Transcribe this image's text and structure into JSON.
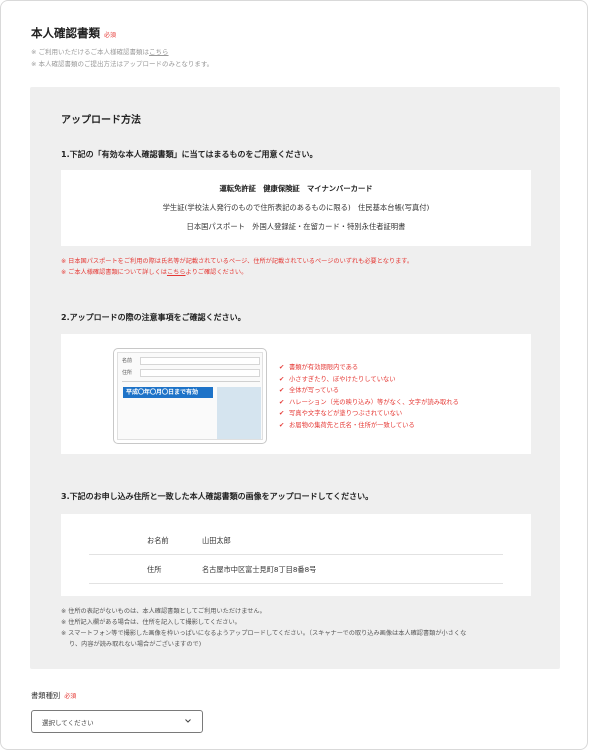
{
  "header": {
    "title": "本人確認書類",
    "required_badge": "必須",
    "note1_prefix": "※ ご利用いただけるご本人様確認書類は",
    "note1_link": "こちら",
    "note2": "※ 本人確認書類のご提出方法はアップロードのみとなります。"
  },
  "upload": {
    "heading": "アップロード方法",
    "step1": {
      "title": "1.下記の「有効な本人確認書類」に当てはまるものをご用意ください。",
      "docs": [
        "運転免許証　健康保険証　マイナンバーカード",
        "学生証(学校法人発行のもので住所表記のあるものに限る)　住民基本台帳(写真付)",
        "日本国パスポート　外国人登録証・在留カード・特別永住者証明書"
      ],
      "note1": "※ 日本国パスポートをご利用の際は氏名等が記載されているページ、住所が記載されているページのいずれも必要となります。",
      "note2_prefix": "※ ご本人様確認書類について詳しくは",
      "note2_link": "こちら",
      "note2_suffix": "よりご確認ください。"
    },
    "step2": {
      "title": "2.アップロードの際の注意事項をご確認ください。",
      "illustration": {
        "name_label": "名前",
        "address_label": "住所",
        "expiry_text": "平成〇年〇月〇日まで有効"
      },
      "checklist": [
        "書類が有効期限内である",
        "小さすぎたり、ぼやけたりしていない",
        "全体が写っている",
        "ハレーション（光の映り込み）等がなく、文字が読み取れる",
        "写真や文字などが塗りつぶされていない",
        "お届物の集荷先と氏名・住所が一致している"
      ],
      "check_mark": "✔"
    },
    "step3": {
      "title": "3.下記のお申し込み住所と一致した本人確認書類の画像をアップロードしてください。",
      "rows": [
        {
          "label": "お名前",
          "value": "山田太郎"
        },
        {
          "label": "住所",
          "value": "名古屋市中区富士見町8丁目8番8号"
        }
      ],
      "notes": [
        "※ 住所の表記がないものは、本人確認書類としてご利用いただけません。",
        "※ 住所記入欄がある場合は、住所を記入して撮影してください。",
        "※ スマートフォン等で撮影した画像を枠いっぱいになるようアップロードしてください。（スキャナーでの取り込み画像は本人確認書類が小さくな",
        "り、内容が読み取れない場合がございますので)"
      ]
    }
  },
  "document_type": {
    "label": "書類種別",
    "required_badge": "必須",
    "select_value": "選択してください"
  },
  "colors": {
    "accent_red": "#e53935",
    "highlight_blue": "#1e73c8",
    "panel_bg": "#efefef"
  }
}
